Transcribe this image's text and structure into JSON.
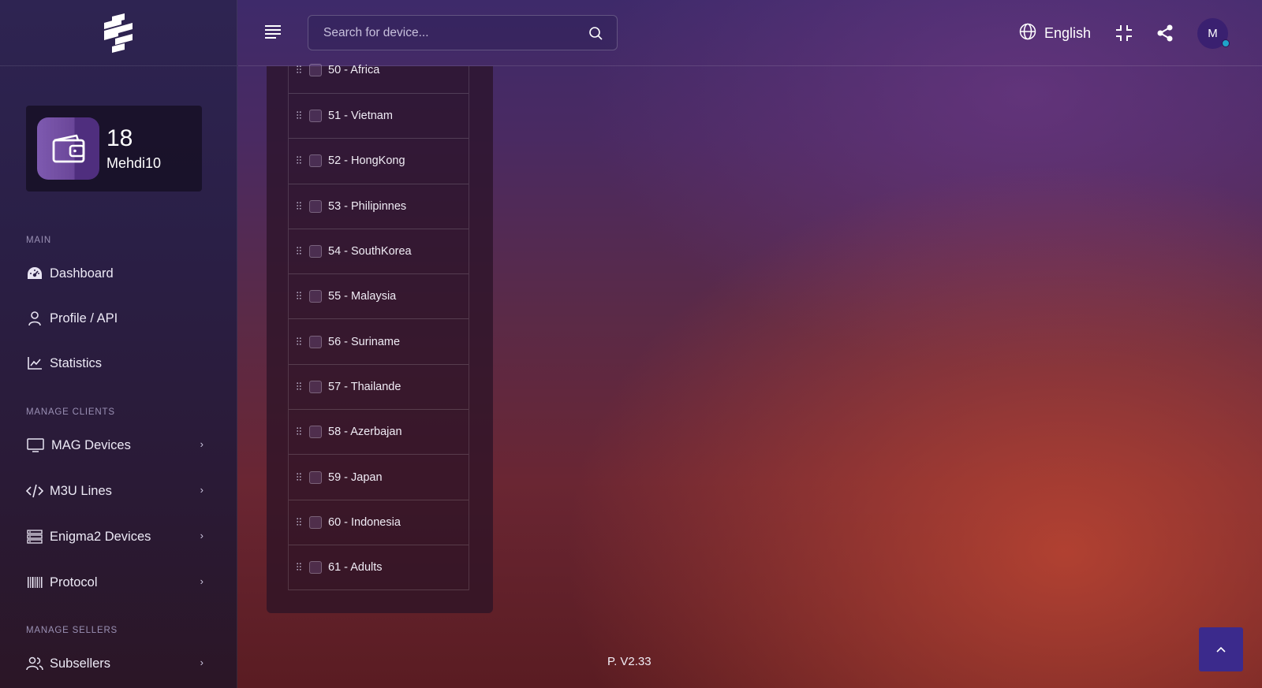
{
  "header": {
    "search_placeholder": "Search for device...",
    "language": "English",
    "avatar_initial": "M"
  },
  "wallet": {
    "count": "18",
    "username": "Mehdi10"
  },
  "sidebar": {
    "sections": {
      "main": "MAIN",
      "manage_clients": "MANAGE CLIENTS",
      "manage_sellers": "MANAGE SELLERS"
    },
    "items": [
      {
        "label": "Dashboard",
        "icon": "dashboard-icon",
        "has_children": false
      },
      {
        "label": "Profile / API",
        "icon": "user-icon",
        "has_children": false
      },
      {
        "label": "Statistics",
        "icon": "chart-line-icon",
        "has_children": false
      },
      {
        "label": "MAG Devices",
        "icon": "monitor-icon",
        "has_children": true
      },
      {
        "label": "M3U Lines",
        "icon": "code-icon",
        "has_children": true
      },
      {
        "label": "Enigma2 Devices",
        "icon": "server-icon",
        "has_children": true
      },
      {
        "label": "Protocol",
        "icon": "barcode-icon",
        "has_children": true
      },
      {
        "label": "Subsellers",
        "icon": "users-icon",
        "has_children": true
      }
    ]
  },
  "channels": [
    {
      "label": "50 - Africa",
      "checked": false
    },
    {
      "label": "51 - Vietnam",
      "checked": false
    },
    {
      "label": "52 - HongKong",
      "checked": false
    },
    {
      "label": "53 - Philipinnes",
      "checked": false
    },
    {
      "label": "54 - SouthKorea",
      "checked": false
    },
    {
      "label": "55 - Malaysia",
      "checked": false
    },
    {
      "label": "56 - Suriname",
      "checked": false
    },
    {
      "label": "57 - Thailande",
      "checked": false
    },
    {
      "label": "58 - Azerbajan",
      "checked": false
    },
    {
      "label": "59 - Japan",
      "checked": false
    },
    {
      "label": "60 - Indonesia",
      "checked": false
    },
    {
      "label": "61 - Adults",
      "checked": false
    }
  ],
  "footer": {
    "version": "P. V2.33"
  },
  "colors": {
    "accent": "#3b2a8c",
    "online": "#1fa3c9"
  }
}
